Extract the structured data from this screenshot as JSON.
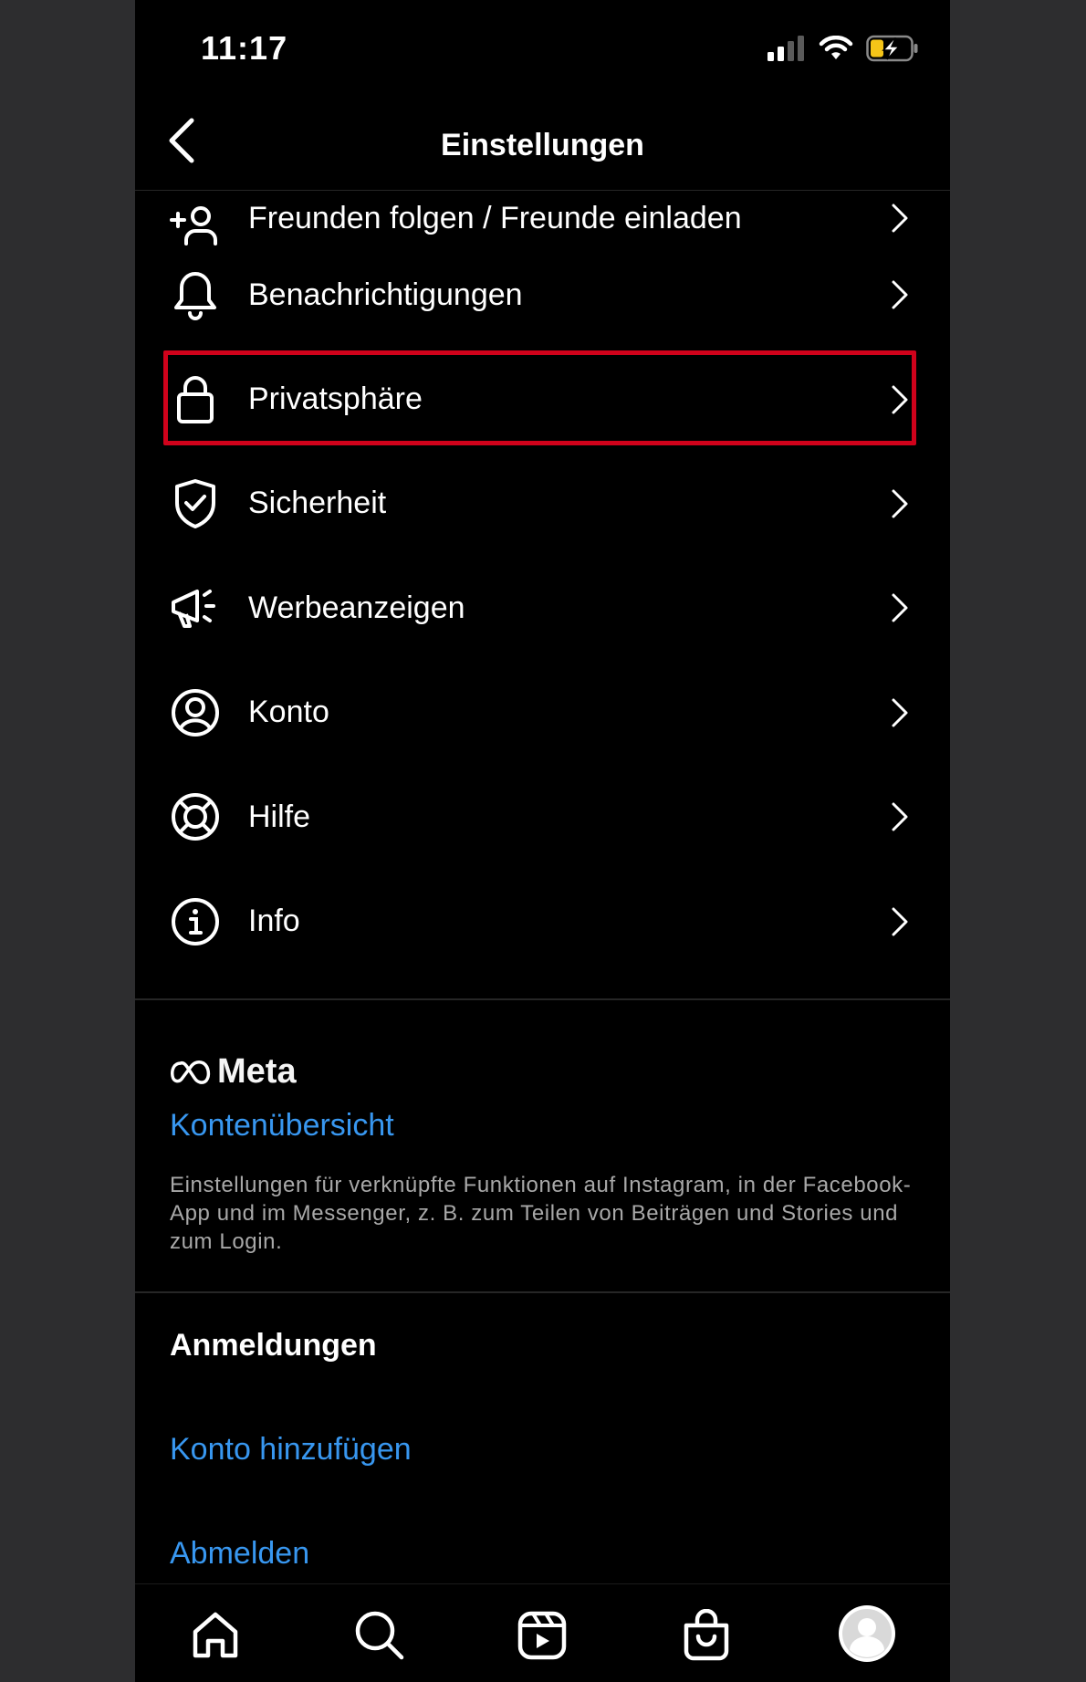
{
  "status_bar": {
    "time": "11:17",
    "icons": [
      "cellular-signal-icon",
      "wifi-icon",
      "battery-charging-icon"
    ]
  },
  "header": {
    "title": "Einstellungen",
    "back_icon": "chevron-left-icon"
  },
  "settings_items": [
    {
      "label": "Freunden folgen / Freunde einladen",
      "icon": "add-person-icon"
    },
    {
      "label": "Benachrichtigungen",
      "icon": "bell-icon"
    },
    {
      "label": "Privatsphäre",
      "icon": "lock-icon",
      "highlighted": true
    },
    {
      "label": "Sicherheit",
      "icon": "shield-check-icon"
    },
    {
      "label": "Werbeanzeigen",
      "icon": "megaphone-icon"
    },
    {
      "label": "Konto",
      "icon": "account-circle-icon"
    },
    {
      "label": "Hilfe",
      "icon": "lifebuoy-icon"
    },
    {
      "label": "Info",
      "icon": "info-icon"
    }
  ],
  "meta": {
    "logo_text": "Meta",
    "accounts_center_link": "Kontenübersicht",
    "description": "Einstellungen für verknüpfte Funktionen auf Instagram, in der Facebook-App und im Messenger, z. B. zum Teilen von Beiträgen und Stories und zum Login."
  },
  "logins": {
    "title": "Anmeldungen",
    "add_account": "Konto hinzufügen",
    "logout": "Abmelden"
  },
  "tab_bar": {
    "tabs": [
      "home-icon",
      "search-icon",
      "reels-icon",
      "shop-icon",
      "profile-avatar"
    ]
  },
  "colors": {
    "background": "#000000",
    "link": "#3897f0",
    "highlight_border": "#d0021b",
    "secondary_text": "#a8a8a8",
    "battery_charge": "#f5c518"
  }
}
